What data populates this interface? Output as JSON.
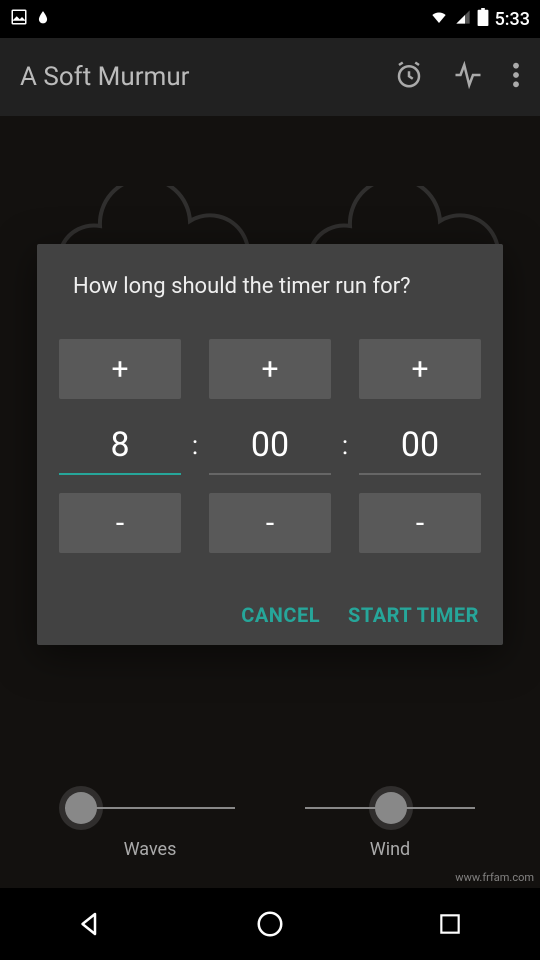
{
  "status": {
    "time": "5:33"
  },
  "app": {
    "title": "A Soft Murmur"
  },
  "dialog": {
    "title": "How long should the timer run for?",
    "plus": "+",
    "minus": "-",
    "colon": ":",
    "hours": "8",
    "minutes": "00",
    "seconds": "00",
    "cancel": "CANCEL",
    "start": "START TIMER"
  },
  "sounds": {
    "waves": {
      "label": "Waves",
      "value": 0.08
    },
    "wind": {
      "label": "Wind",
      "value": 0.45
    }
  },
  "watermark": "www.frfam.com"
}
